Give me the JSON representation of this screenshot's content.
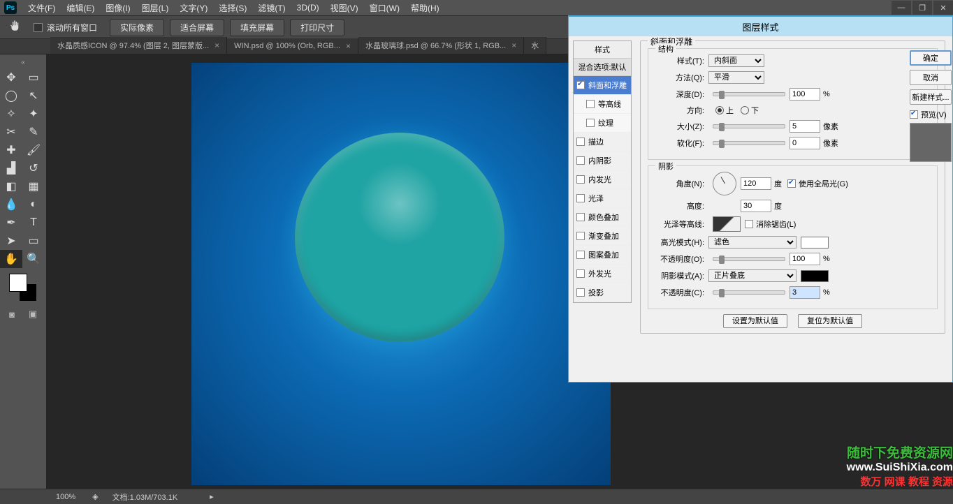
{
  "menu": {
    "items": [
      "文件(F)",
      "编辑(E)",
      "图像(I)",
      "图层(L)",
      "文字(Y)",
      "选择(S)",
      "滤镜(T)",
      "3D(D)",
      "视图(V)",
      "窗口(W)",
      "帮助(H)"
    ]
  },
  "options": {
    "scroll_all_label": "滚动所有窗口",
    "buttons": [
      "实际像素",
      "适合屏幕",
      "填充屏幕",
      "打印尺寸"
    ]
  },
  "tabs": [
    {
      "label": "水晶质感ICON @ 97.4% (图层 2, 图层蒙版..."
    },
    {
      "label": "WIN.psd @ 100% (Orb, RGB..."
    },
    {
      "label": "水晶玻璃球.psd @ 66.7% (形状 1, RGB..."
    },
    {
      "label": "水"
    }
  ],
  "statusbar": {
    "zoom": "100%",
    "doc": "文档:1.03M/703.1K"
  },
  "dialog": {
    "title": "图层样式",
    "styles_header": "样式",
    "blend_header": "混合选项:默认",
    "style_items": [
      {
        "label": "斜面和浮雕",
        "checked": true,
        "active": true
      },
      {
        "label": "等高线",
        "checked": false,
        "sub": true
      },
      {
        "label": "纹理",
        "checked": false,
        "sub": true
      },
      {
        "label": "描边",
        "checked": false
      },
      {
        "label": "内阴影",
        "checked": false
      },
      {
        "label": "内发光",
        "checked": false
      },
      {
        "label": "光泽",
        "checked": false
      },
      {
        "label": "颜色叠加",
        "checked": false
      },
      {
        "label": "渐变叠加",
        "checked": false
      },
      {
        "label": "图案叠加",
        "checked": false
      },
      {
        "label": "外发光",
        "checked": false
      },
      {
        "label": "投影",
        "checked": false
      }
    ],
    "group_title": "斜面和浮雕",
    "structure": {
      "title": "结构",
      "style_label": "样式(T):",
      "style_value": "内斜面",
      "method_label": "方法(Q):",
      "method_value": "平滑",
      "depth_label": "深度(D):",
      "depth_value": "100",
      "depth_unit": "%",
      "direction_label": "方向:",
      "up_label": "上",
      "down_label": "下",
      "size_label": "大小(Z):",
      "size_value": "5",
      "size_unit": "像素",
      "soften_label": "软化(F):",
      "soften_value": "0",
      "soften_unit": "像素"
    },
    "shading": {
      "title": "阴影",
      "angle_label": "角度(N):",
      "angle_value": "120",
      "angle_unit": "度",
      "global_label": "使用全局光(G)",
      "altitude_label": "高度:",
      "altitude_value": "30",
      "altitude_unit": "度",
      "gloss_label": "光泽等高线:",
      "aa_label": "消除锯齿(L)",
      "hl_mode_label": "高光模式(H):",
      "hl_mode_value": "滤色",
      "hl_opacity_label": "不透明度(O):",
      "hl_opacity_value": "100",
      "hl_opacity_unit": "%",
      "sh_mode_label": "阴影模式(A):",
      "sh_mode_value": "正片叠底",
      "sh_opacity_label": "不透明度(C):",
      "sh_opacity_value": "3",
      "sh_opacity_unit": "%"
    },
    "default_btn": "设置为默认值",
    "reset_btn": "复位为默认值",
    "side": {
      "ok": "确定",
      "cancel": "取消",
      "new_style": "新建样式...",
      "preview": "预览(V)"
    }
  },
  "watermark": {
    "line1": "随时下免费资源网",
    "line2": "www.SuiShiXia.com",
    "line3": "数万 网课 教程 资源"
  }
}
